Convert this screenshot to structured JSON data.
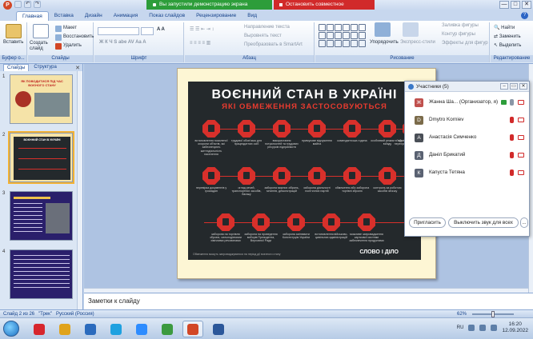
{
  "window": {
    "quick_access": [
      "save-icon",
      "undo-icon",
      "redo-icon"
    ],
    "controls": [
      "—",
      "□",
      "✕"
    ]
  },
  "share_bar": {
    "status": "Вы запустили демонстрацию экрана",
    "stop": "Остановить совместное использование",
    "status_color": "#2d9d3a",
    "stop_color": "#d12a2a"
  },
  "ribbon_tabs": [
    "Главная",
    "Вставка",
    "Дизайн",
    "Анимация",
    "Показ слайдов",
    "Рецензирование",
    "Вид"
  ],
  "ribbon": {
    "clipboard": {
      "paste": "Вставить",
      "cut": "",
      "copy": "",
      "label": "Буфер о..."
    },
    "slides": {
      "create": "Создать слайд",
      "layout": "Макет",
      "reset": "Восстановить",
      "delete": "Удалить",
      "label": "Слайды"
    },
    "font": {
      "label": "Шрифт"
    },
    "paragraph": {
      "direction": "Направление текста",
      "align": "Выровнять текст",
      "smartart": "Преобразовать в SmartArt",
      "label": "Абзац"
    },
    "drawing": {
      "arrange": "Упорядочить",
      "quick_styles": "Экспресс-стили",
      "fill": "Заливка фигуры",
      "outline": "Контур фигуры",
      "effects": "Эффекты для фигур",
      "label": "Рисование"
    },
    "editing": {
      "find": "Найти",
      "replace": "Заменить",
      "select": "Выделить",
      "label": "Редактирование"
    }
  },
  "left_panel": {
    "tabs": [
      "Слайды",
      "Структура"
    ],
    "thumbs": [
      {
        "num": "1",
        "title": "ЯК ПОВОДИТИСЯ ПІД ЧАС ВОЄНОГО СТАНУ"
      },
      {
        "num": "2",
        "title": "ВОЄННИЙ СТАН В УКРАЇНІ"
      },
      {
        "num": "3",
        "title": ""
      },
      {
        "num": "4",
        "title": ""
      }
    ]
  },
  "slide": {
    "title": "ВОЄННИЙ СТАН В УКРАЇНІ",
    "subtitle": "ЯКІ ОБМЕЖЕННЯ ЗАСТОСОВУЮТЬСЯ",
    "brand": "СЛОВО І ДІЛО",
    "captions": [
      "встановлення посиленої охорони об'єктів, які забезпечують життєдіяльність населення",
      "трудової обов'язок для працездатних осіб",
      "використання потужностей та трудових ресурсів підприємств",
      "примусове відчуження майна",
      "комендантська година",
      "особливий режим в'їзду і виїзду",
      "обмеження свободи пересування громадян та ТЗ",
      "перевірка документів у громадян",
      "огляд речей, транспортних засобів, багажу",
      "заборона мирних зібрань, мітингів, демонстрацій",
      "заборона діяльності політичних партій",
      "обмеження або заборона торгівлі зброєю",
      "контроль за роботою засобів зв'язку",
      "заборона на торгівлю зброєю, сильнодіючими хімічними речовинами",
      "заборона на проведення виборів Президента, Верховної Ради",
      "заборона змінювати Конституцію України",
      "встановлення військово-цивільних адміністрацій",
      "можливе запровадження карткової системи забезпечення продуктами"
    ],
    "footnote": "Обмеження можуть запроваджуватися на період дії воєнного стану"
  },
  "notes": {
    "placeholder": "Заметки к слайду"
  },
  "statusbar": {
    "slide_info": "Слайд 2 из 26",
    "theme": "\"Трек\"",
    "language": "Русский (Россия)",
    "zoom": "62%"
  },
  "participants": {
    "title": "Участники (5)",
    "list": [
      {
        "name": "Жанна Ша... (Организатор, я)",
        "initial": "Ж",
        "color": "#c0504d",
        "mic_color": "#8a96a6"
      },
      {
        "name": "Dmytro Korniev",
        "initial": "D",
        "color": "#7b6b4a",
        "mic_color": "#d12a2a"
      },
      {
        "name": "Анастасія Симченко",
        "initial": "А",
        "color": "#4a4f57",
        "mic_color": "#d12a2a"
      },
      {
        "name": "Даніл Брикатий",
        "initial": "Д",
        "color": "#5a6272",
        "mic_color": "#d12a2a"
      },
      {
        "name": "Капуста Тетяна",
        "initial": "К",
        "color": "#5a6272",
        "mic_color": "#d12a2a"
      }
    ],
    "invite": "Пригласить",
    "mute_all": "Выключить звук для всех",
    "more": "..."
  },
  "taskbar": {
    "apps": [
      {
        "name": "opera",
        "color": "#d7262d"
      },
      {
        "name": "file-manager",
        "color": "#e0a31c"
      },
      {
        "name": "photo-viewer",
        "color": "#2b6bbd"
      },
      {
        "name": "skype",
        "color": "#1ea1e0"
      },
      {
        "name": "zoom",
        "color": "#2d8cff"
      },
      {
        "name": "chrome",
        "color": "#3c9a3f"
      },
      {
        "name": "powerpoint",
        "color": "#d24726"
      },
      {
        "name": "word",
        "color": "#2b579a"
      }
    ],
    "lang": "RU",
    "time": "16:20",
    "date": "12.09.2022"
  },
  "colors": {
    "accent": "#15428b",
    "slide_red": "#d8302b",
    "slide_bg": "#24292c"
  }
}
